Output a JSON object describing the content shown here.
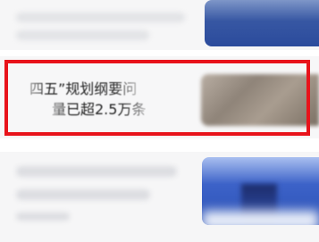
{
  "feed": {
    "highlighted_item": {
      "title_line_1": "四五”规划纲要问",
      "title_line_2": "量已超2.5万条"
    },
    "colors": {
      "highlight_border": "#e8131b",
      "background": "#ffffff"
    }
  }
}
